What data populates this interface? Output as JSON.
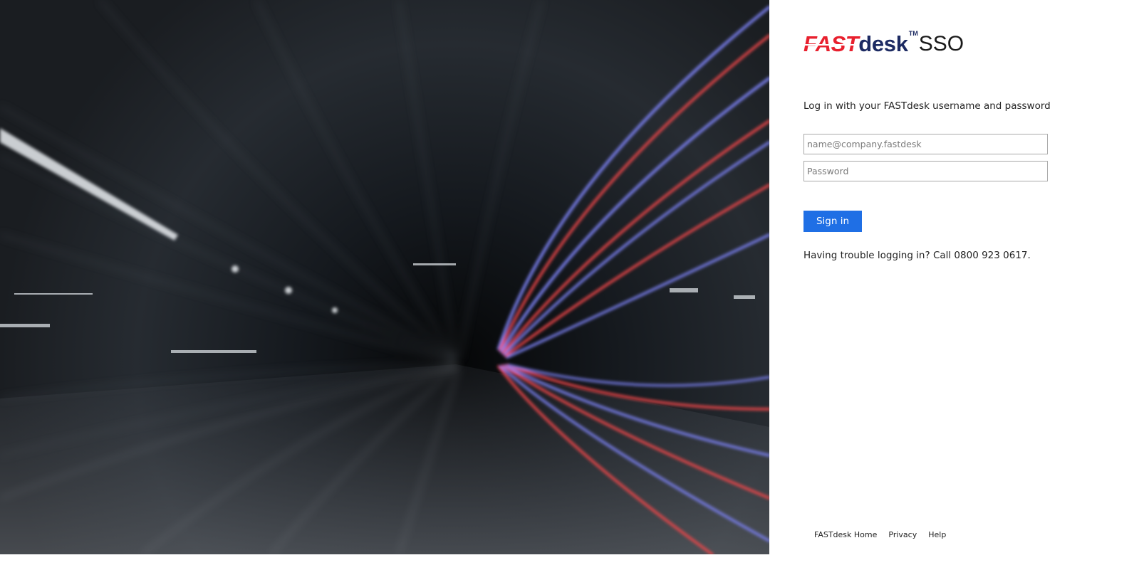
{
  "hero": {
    "icon": "light-trails-illustration",
    "colors": {
      "background": "#111418",
      "trail_blue": "#7a80f0",
      "trail_red": "#f0464a"
    }
  },
  "logo": {
    "fast": "FAST",
    "desk": "desk",
    "tm": "TM",
    "sso": "SSO",
    "colors": {
      "fast": "#e8202e",
      "desk": "#1c2a62"
    }
  },
  "login": {
    "intro": "Log in with your FASTdesk username and password",
    "username_placeholder": "name@company.fastdesk",
    "username_value": "",
    "password_placeholder": "Password",
    "password_value": "",
    "signin_label": "Sign in",
    "trouble_text": "Having trouble logging in? Call 0800 923 0617.",
    "colors": {
      "button": "#1f6fe5"
    }
  },
  "footer": {
    "links": [
      "FASTdesk Home",
      "Privacy",
      "Help"
    ]
  }
}
